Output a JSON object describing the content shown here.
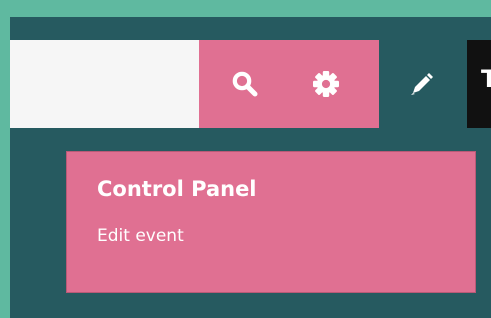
{
  "colors": {
    "outer_frame": "#5fb9a0",
    "background": "#265a60",
    "accent": "#e07092",
    "input_background": "#f6f6f6",
    "dark_slot": "#111111",
    "text": "#ffffff"
  },
  "toolbar": {
    "search_input_value": "",
    "search_icon": "search-icon",
    "settings_icon": "gear-icon",
    "edit_icon": "pencil-icon",
    "dark_slot_label": "T"
  },
  "panel": {
    "title": "Control Panel",
    "subtitle": "Edit event"
  }
}
